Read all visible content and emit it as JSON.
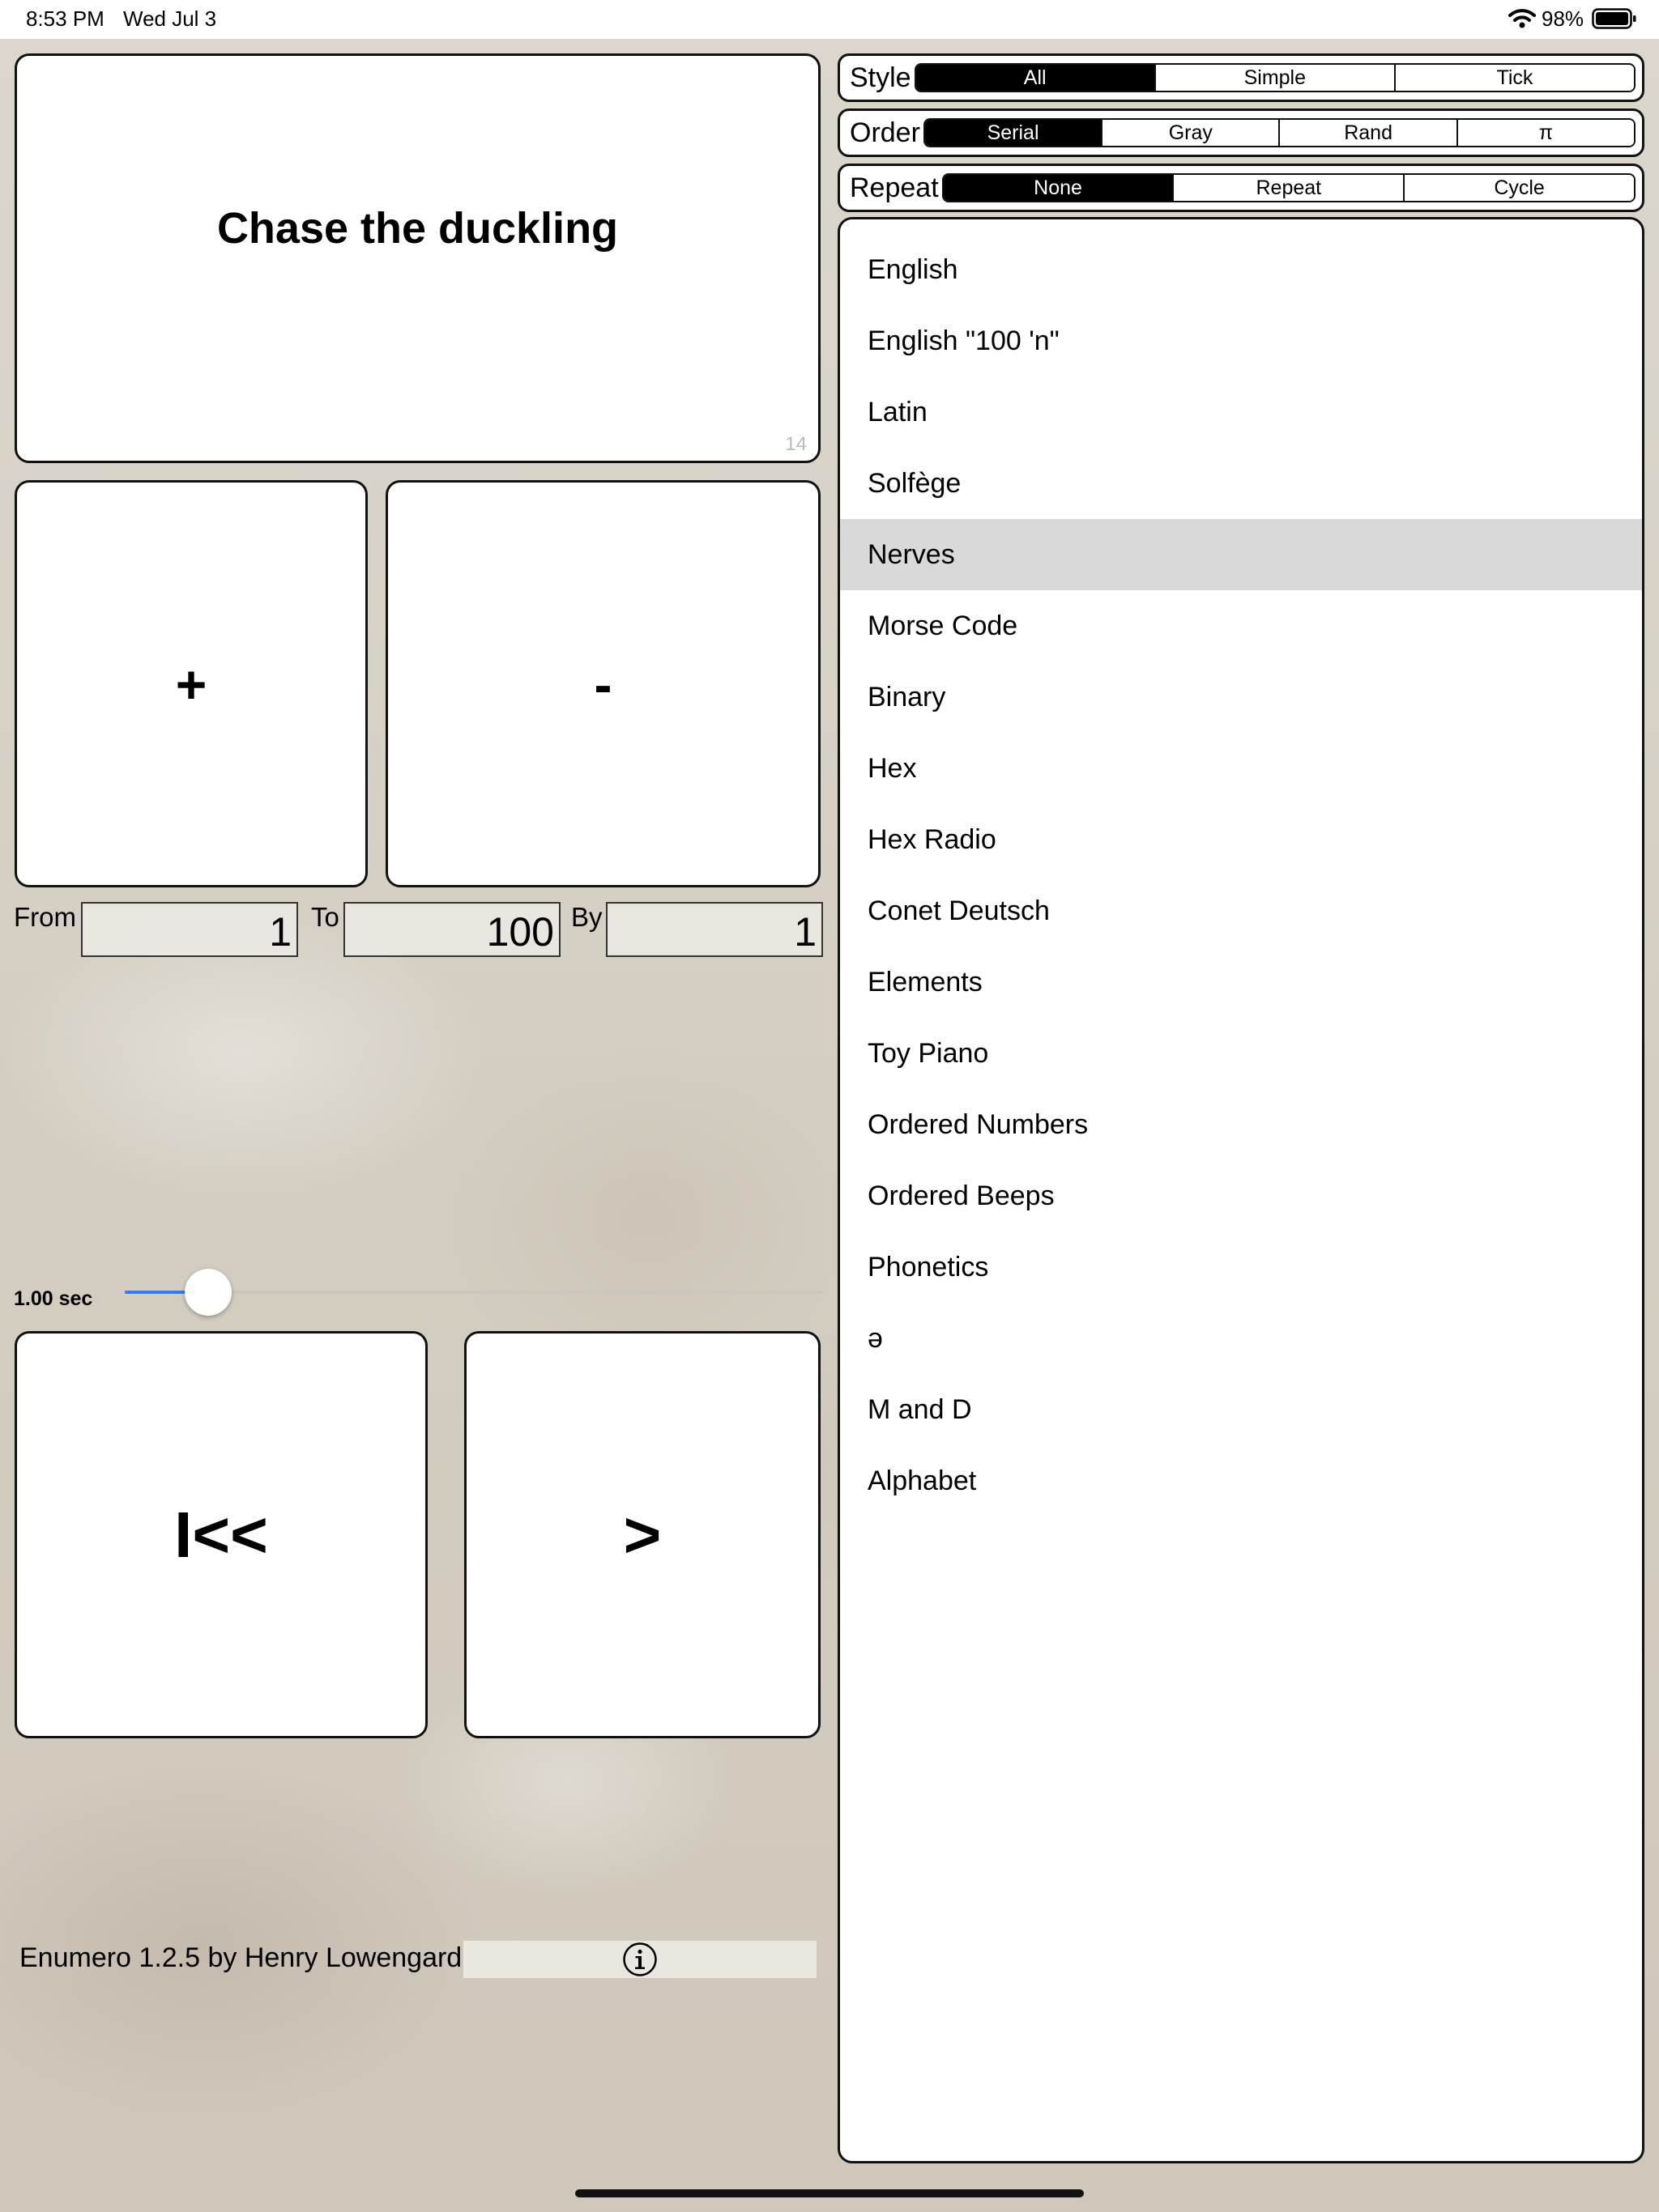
{
  "status_bar": {
    "time": "8:53 PM",
    "date": "Wed Jul 3",
    "battery": "98%"
  },
  "display": {
    "text": "Chase the duckling",
    "counter": "14"
  },
  "buttons": {
    "plus": "+",
    "minus": "-",
    "reset": "I<<",
    "play": ">"
  },
  "range": {
    "from_label": "From",
    "from_value": "1",
    "to_label": "To",
    "to_value": "100",
    "by_label": "By",
    "by_value": "1"
  },
  "speed": {
    "label": "1.00 sec",
    "level_fraction": 0.12
  },
  "footer": {
    "credit": "Enumero 1.2.5 by Henry Lowengard",
    "info_icon": "info-icon"
  },
  "style": {
    "title": "Style",
    "options": [
      "All",
      "Simple",
      "Tick"
    ],
    "selected": "All"
  },
  "order": {
    "title": "Order",
    "options": [
      "Serial",
      "Gray",
      "Rand",
      "π"
    ],
    "selected": "Serial"
  },
  "repeat": {
    "title": "Repeat",
    "options": [
      "None",
      "Repeat",
      "Cycle"
    ],
    "selected": "None"
  },
  "list": {
    "items": [
      "English",
      "English \"100 'n\"",
      "Latin",
      "Solfège",
      "Nerves",
      "Morse Code",
      "Binary",
      "Hex",
      "Hex Radio",
      "Conet Deutsch",
      "Elements",
      "Toy Piano",
      "Ordered Numbers",
      "Ordered Beeps",
      "Phonetics",
      "ə",
      "M and D",
      "Alphabet"
    ],
    "selected": "Nerves"
  },
  "colors": {
    "slider_accent": "#2f7cf6",
    "selected_row": "#d9d9d9"
  }
}
